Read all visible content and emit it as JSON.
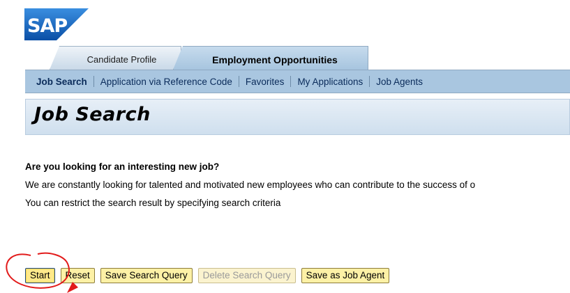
{
  "brand": {
    "logo_text": "SAP",
    "logo_color": "#0a5bb5"
  },
  "tabs": [
    {
      "label": "Candidate Profile",
      "active": false
    },
    {
      "label": "Employment Opportunities",
      "active": true
    }
  ],
  "subnav": {
    "items": [
      {
        "label": "Job Search",
        "active": true
      },
      {
        "label": "Application via Reference Code",
        "active": false
      },
      {
        "label": "Favorites",
        "active": false
      },
      {
        "label": "My Applications",
        "active": false
      },
      {
        "label": "Job Agents",
        "active": false
      }
    ]
  },
  "page": {
    "title": "Job Search",
    "headline": "Are you looking for an interesting new job?",
    "paragraph1": "We are constantly looking for talented and motivated new employees who can contribute to the success of o",
    "paragraph2": "You can restrict the search result by specifying search criteria"
  },
  "buttons": {
    "start": "Start",
    "reset": "Reset",
    "save_query": "Save Search Query",
    "delete_query": "Delete Search Query",
    "save_agent": "Save as Job Agent"
  },
  "colors": {
    "annotation": "#e21b1b",
    "subnav_bg": "#a9c6e0"
  }
}
